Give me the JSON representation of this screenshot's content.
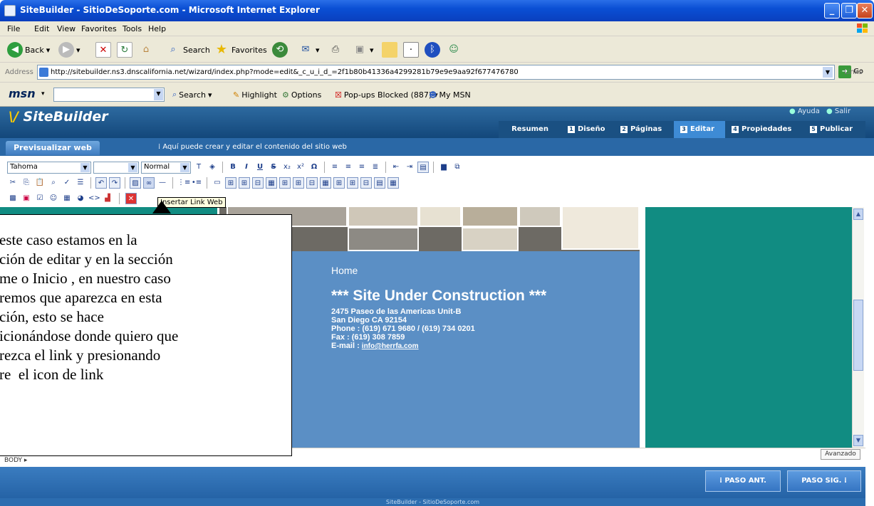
{
  "window": {
    "title": "SiteBuilder - SitioDeSoporte.com - Microsoft Internet Explorer"
  },
  "menu": [
    "File",
    "Edit",
    "View",
    "Favorites",
    "Tools",
    "Help"
  ],
  "toolbar": {
    "back": "Back",
    "search": "Search",
    "favorites": "Favorites"
  },
  "address": {
    "label": "Address",
    "url": "http://sitebuilder.ns3.dnscalifornia.net/wizard/index.php?mode=edit&_c_u_i_d_=2f1b80b41336a4299281b79e9e9aa92f677476780",
    "go": "Go",
    "links": "Links"
  },
  "msn": {
    "logo": "msn",
    "search": "Search",
    "highlight": "Highlight",
    "options": "Options",
    "popups": "Pop-ups Blocked (887)",
    "mymsn": "My MSN"
  },
  "sitebuilder": {
    "logo": "SiteBuilder",
    "help": "Ayuda",
    "exit": "Salir",
    "tabs": [
      {
        "label": "Resumen",
        "num": ""
      },
      {
        "label": "Diseño",
        "num": "1"
      },
      {
        "label": "Páginas",
        "num": "2"
      },
      {
        "label": "Editar",
        "num": "3"
      },
      {
        "label": "Propiedades",
        "num": "4"
      },
      {
        "label": "Publicar",
        "num": "5"
      }
    ],
    "preview": "Previsualizar web",
    "subinfo": "Aquí puede crear y editar el contenido del sitio web"
  },
  "editor": {
    "font": "Tahoma",
    "size": "",
    "style": "Normal",
    "tooltip": "Insertar Link Web"
  },
  "page": {
    "home": "Home",
    "headline": "*** Site Under Construction ***",
    "address1": "2475 Paseo de las Americas Unit-B",
    "address2": "San Diego CA 92154",
    "phone": "Phone : (619) 671 9680 / (619) 734 0201",
    "fax": "Fax : (619) 308 7859",
    "email_label": "E-mail :",
    "email": "info@herrfa.com"
  },
  "callout": {
    "lines": [
      "este caso estamos en la",
      "ción de editar y en la sección",
      "me o Inicio , en nuestro caso",
      "remos que aparezca en esta",
      "ción, esto se hace",
      "icionándose donde quiero que",
      "rezca el link y presionando",
      "re  el icon de link"
    ]
  },
  "status": {
    "path": "BODY ▸",
    "advanced": "Avanzado"
  },
  "steps": {
    "prev": "PASO ANT.",
    "next": "PASO SIG."
  },
  "footer": "SiteBuilder - SitioDeSoporte.com"
}
